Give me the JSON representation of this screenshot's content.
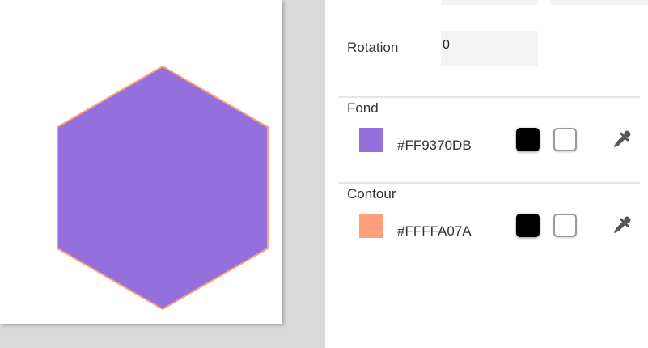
{
  "rotation": {
    "label": "Rotation",
    "value": "0"
  },
  "fill": {
    "title": "Fond",
    "hex": "#FF9370DB",
    "color": "#9370DB",
    "presets": [
      "#000000",
      "#FFFFFF"
    ],
    "picker_icon": "eyedropper-icon"
  },
  "stroke": {
    "title": "Contour",
    "hex": "#FFFFA07A",
    "color": "#FFA07A",
    "presets": [
      "#000000",
      "#FFFFFF"
    ],
    "picker_icon": "eyedropper-icon"
  },
  "shape": {
    "type": "hexagon",
    "fill": "#9370DB",
    "stroke": "#FFA07A"
  }
}
